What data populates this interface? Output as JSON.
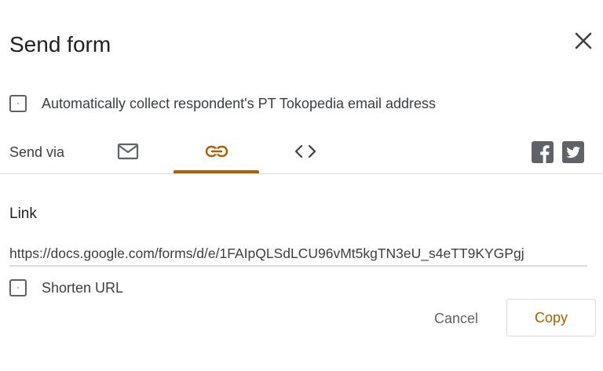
{
  "dialog": {
    "title": "Send form",
    "collect_email_label": "Automatically collect respondent's PT Tokopedia email address",
    "send_via_label": "Send via",
    "tabs": [
      {
        "name": "email",
        "icon": "mail-icon",
        "active": false
      },
      {
        "name": "link",
        "icon": "link-icon",
        "active": true
      },
      {
        "name": "embed",
        "icon": "code-icon",
        "active": false
      }
    ],
    "share_icons": [
      "facebook-icon",
      "twitter-icon"
    ],
    "link_section": {
      "heading": "Link",
      "url": "https://docs.google.com/forms/d/e/1FAIpQLSdLCU96vMt5kgTN3eU_s4eTT9KYGPgj",
      "shorten_label": "Shorten URL"
    },
    "buttons": {
      "cancel": "Cancel",
      "copy": "Copy"
    }
  },
  "colors": {
    "accent": "#b06000",
    "icon_gray": "#5f6368",
    "divider": "#dadce0"
  }
}
